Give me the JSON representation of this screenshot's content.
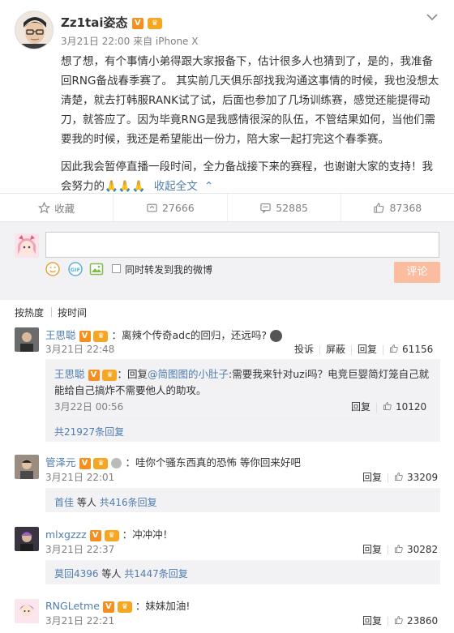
{
  "post": {
    "author": "Zz1tai姿态",
    "badge_v": "V",
    "meta": "3月21日 22:00 来自 iPhone X",
    "body_p1": "想了想，有个事情小弟得跟大家报备下，估计很多人也猜到了，是的，我准备回RNG备战春季赛了。 其实前几天俱乐部找我沟通这事情的时候，我也没想太清楚，就去打韩服RANK试了试，后面也参加了几场训练赛，感觉还能提得动刀，就答应了。因为毕竟RNG是我感情很深的队伍，不管结果如何，当他们需要我的时候，我还是希望能出一份力，陪大家一起打完这个春季赛。",
    "body_p2": "因此我会暂停直播一段时间，全力备战接下来的赛程，也谢谢大家的支持！我会努力的",
    "emojis": "🙏🙏🙏",
    "collapse": "收起全文",
    "collapse_arrow": "⌃"
  },
  "actions": {
    "favorite": "收藏",
    "repost": "27666",
    "comment": "52885",
    "like": "87368"
  },
  "compose": {
    "placeholder": "",
    "repost_label": "同时转发到我的微博",
    "submit": "评论"
  },
  "sort": {
    "hot": "按热度",
    "time": "按时间"
  },
  "comments": [
    {
      "user": "王思聪",
      "text": "：离辣个传奇adc的回归，还远吗?",
      "time": "3月21日 22:48",
      "report": "投诉",
      "block": "屏蔽",
      "reply": "回复",
      "likes": "61156",
      "sub": {
        "user": "王思聪",
        "prefix": "：回复",
        "mention": "@简图图的小肚子",
        "text": ":需要我来针对uzi吗？电竞巨婴简灯笼自己就能给自己搞炸不需要他人的助攻。",
        "time": "3月22日 00:56",
        "reply": "回复",
        "likes": "10120"
      },
      "more": "共21927条回复"
    },
    {
      "user": "管泽元",
      "text": "：哇你个骚东西真的恐怖 等你回来好吧",
      "time": "3月21日 22:01",
      "reply": "回复",
      "likes": "33209",
      "more_user": "首佳",
      "more_mid": "等人",
      "more": "共416条回复"
    },
    {
      "user": "mlxgzzz",
      "text": "：冲冲冲！",
      "time": "3月21日 22:37",
      "reply": "回复",
      "likes": "30282",
      "more_user": "莫回4396",
      "more_mid": "等人",
      "more": "共1447条回复"
    },
    {
      "user": "RNGLetme",
      "text": "：妹妹加油!",
      "time": "3月21日 22:21",
      "reply": "回复",
      "likes": "23860"
    }
  ]
}
